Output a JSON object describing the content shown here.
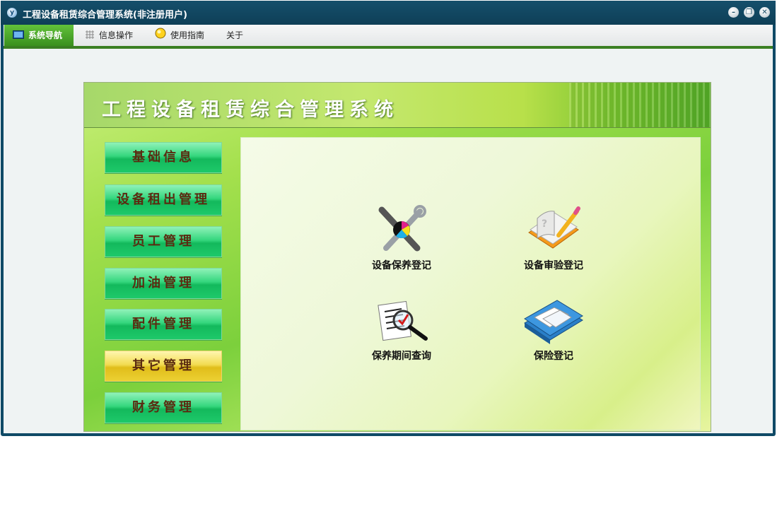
{
  "window": {
    "title": "工程设备租赁综合管理系统(非注册用户)",
    "logo_text": "y",
    "controls": [
      "minimize-icon",
      "restore-icon",
      "close-icon"
    ]
  },
  "menubar": {
    "items": [
      {
        "label": "系统导航",
        "icon": "monitor-icon",
        "active": true
      },
      {
        "label": "信息操作",
        "icon": "grid-icon",
        "active": false
      },
      {
        "label": "使用指南",
        "icon": "lightbulb-icon",
        "active": false
      },
      {
        "label": "关于",
        "icon": "",
        "active": false
      }
    ]
  },
  "panel": {
    "title": "工程设备租赁综合管理系统"
  },
  "sidebar": {
    "items": [
      {
        "label": "基础信息",
        "selected": false
      },
      {
        "label": "设备租出管理",
        "selected": false
      },
      {
        "label": "员工管理",
        "selected": false
      },
      {
        "label": "加油管理",
        "selected": false
      },
      {
        "label": "配件管理",
        "selected": false
      },
      {
        "label": "其它管理",
        "selected": true
      },
      {
        "label": "财务管理",
        "selected": false
      }
    ]
  },
  "functions": [
    {
      "label": "设备保养登记",
      "icon": "tools-icon"
    },
    {
      "label": "设备审验登记",
      "icon": "notebook-pencil-icon"
    },
    {
      "label": "保养期间查询",
      "icon": "magnifier-document-icon"
    },
    {
      "label": "保险登记",
      "icon": "books-icon"
    }
  ],
  "colors": {
    "titlebar": "#0f4a66",
    "menu_active": "#4caf2a",
    "button_green": "#1ec96a",
    "button_selected": "#ecd033",
    "button_text": "#5a2a10"
  }
}
